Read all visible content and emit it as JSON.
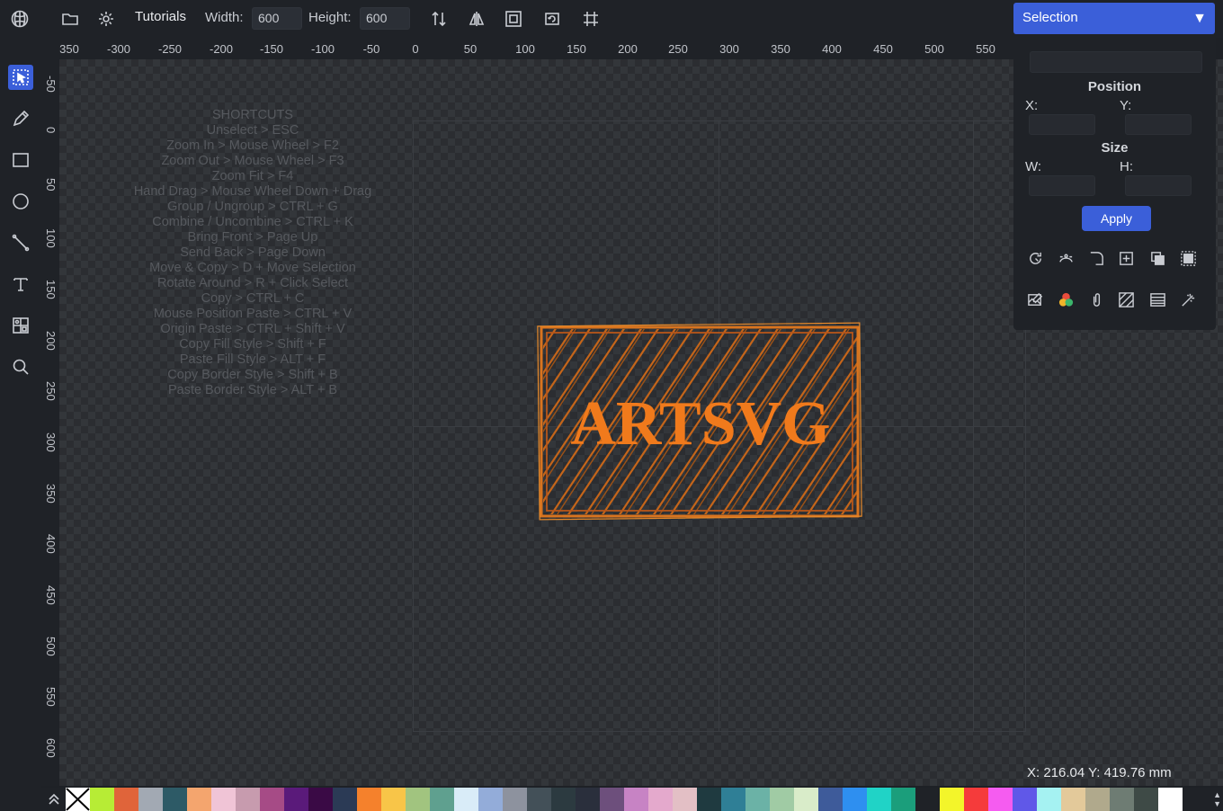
{
  "app": {
    "logo_icon": "app-logo-icon",
    "tutorials_label": "Tutorials"
  },
  "toolbar": {
    "width_label": "Width:",
    "width_value": "600",
    "height_label": "Height:",
    "height_value": "600",
    "icons": [
      "folder-icon",
      "gear-icon",
      "vertical-align-icon",
      "flip-horizontal-icon",
      "fit-frame-icon",
      "rotate-frame-icon",
      "crop-grid-icon"
    ]
  },
  "selection_dropdown": {
    "label": "Selection",
    "caret": "▼"
  },
  "left_tools": [
    "select-tool",
    "pencil-tool",
    "rectangle-tool",
    "ellipse-tool",
    "line-tool",
    "text-tool",
    "gallery-tool",
    "zoom-tool"
  ],
  "ruler_top": [
    "350",
    "-300",
    "-250",
    "-200",
    "-150",
    "-100",
    "-50",
    "0",
    "50",
    "100",
    "150",
    "200",
    "250",
    "300",
    "350",
    "400",
    "450",
    "500",
    "550"
  ],
  "ruler_left": [
    "-50",
    "0",
    "50",
    "100",
    "150",
    "200",
    "250",
    "300",
    "350",
    "400",
    "450",
    "500",
    "550",
    "600"
  ],
  "shortcuts": {
    "title": "SHORTCUTS",
    "items": [
      "Unselect > ESC",
      "Zoom In > Mouse Wheel > F2",
      "Zoom Out > Mouse Wheel > F3",
      "Zoom Fit > F4",
      "Hand Drag > Mouse Wheel Down + Drag",
      "Group / Ungroup > CTRL + G",
      "Combine / Uncombine > CTRL + K",
      "Bring Front > Page Up",
      "Send Back > Page Down",
      "Move & Copy > D + Move Selection",
      "Rotate Around > R + Click Select",
      "Copy > CTRL + C",
      "Mouse Position Paste > CTRL + V",
      "Origin Paste > CTRL + Shift + V",
      "Copy Fill Style > Shift + F",
      "Paste Fill Style > ALT + F",
      "Copy Border Style > Shift + B",
      "Paste Border Style > ALT + B"
    ]
  },
  "artwork": {
    "text": "ARTSVG",
    "accent": "#f07a1c"
  },
  "panel": {
    "name_value": "",
    "position_title": "Position",
    "x_label": "X:",
    "y_label": "Y:",
    "x_value": "",
    "y_value": "",
    "size_title": "Size",
    "w_label": "W:",
    "h_label": "H:",
    "w_value": "",
    "h_value": "",
    "apply_label": "Apply",
    "icon_row_1": [
      "refresh-shape-icon",
      "path-nodes-icon",
      "corner-icon",
      "add-box-icon",
      "layers-icon",
      "select-all-icon"
    ],
    "icon_row_2": [
      "image-edit-icon",
      "color-circles-icon",
      "clip-icon",
      "hatch-fill-icon",
      "pattern-fill-icon",
      "magic-wand-icon"
    ]
  },
  "status": {
    "coords": "X: 216.04 Y: 419.76 mm"
  },
  "palette": {
    "colors": [
      "#b7ec35",
      "#e0643a",
      "#a2a9b3",
      "#2d5a66",
      "#f4a56e",
      "#f0c4d6",
      "#c79bae",
      "#a64b86",
      "#5a1a7a",
      "#3a0a45",
      "#2b3a55",
      "#f5812c",
      "#f8c548",
      "#a1c47f",
      "#5fa08f",
      "#d9ecf8",
      "#93acd9",
      "#8d929e",
      "#435058",
      "#2c3a40",
      "#2a2f3c",
      "#6d4f7c",
      "#c783c4",
      "#e4a9cc",
      "#e3bfc5",
      "#1f3a40",
      "#2f7f96",
      "#6bb2a6",
      "#a0cba4",
      "#d9ecc9",
      "#3e5b9a",
      "#2e8ff0",
      "#20d3c6",
      "#1b9e7b",
      "#1f2227",
      "#f3f52a",
      "#f53b3b",
      "#f55cf0",
      "#6058e8",
      "#a5f2f2",
      "#e3c99a",
      "#b0a98c",
      "#6e7c73",
      "#3e4a46",
      "#ffffff"
    ]
  }
}
